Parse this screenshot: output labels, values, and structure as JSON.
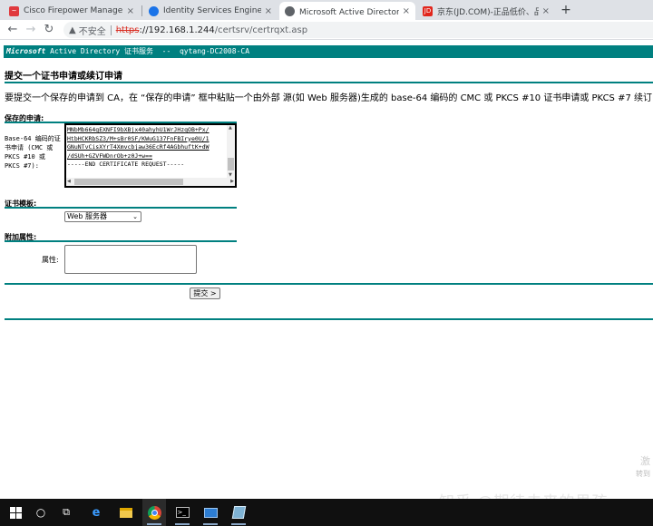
{
  "browser": {
    "tabs": [
      {
        "label": "Cisco Firepower Management",
        "close": "×",
        "favicon": "cisco-icon"
      },
      {
        "label": "Identity Services Engine",
        "close": "×",
        "favicon": "globe-icon"
      },
      {
        "label": "Microsoft Active Directory 证书",
        "close": "×",
        "favicon": "globe-icon"
      },
      {
        "label": "京东(JD.COM)-正品低价、品质保障",
        "close": "×",
        "favicon": "jd-icon",
        "favicon_text": "JD"
      }
    ],
    "new_tab": "+",
    "address": {
      "insecure_label": "不安全",
      "scheme": "https",
      "host": "://192.168.1.244",
      "path": "/certsrv/certrqxt.asp"
    }
  },
  "page": {
    "banner": {
      "brand": "Microsoft",
      "rest": " Active Directory 证书服务  --  qytang-DC2008-CA"
    },
    "heading": "提交一个证书申请或续订申请",
    "intro": "要提交一个保存的申请到 CA，在 “保存的申请” 框中粘贴一个由外部 源(如 Web 服务器)生成的 base-64 编码的 CMC 或 PKCS #10 证书申请或 PKCS #7 续订申",
    "saved_request": {
      "section_label": "保存的申请:",
      "field_label": "Base-64 编码的证书申请 (CMC 或 PKCS #10 或 PKCS #7):",
      "lines": [
        "MNbMb664gEXNFI9bXBjx40ahyhU1WrJHzqOB+Px/",
        "HtbHCKRbSZ3/M+sBr0SF/KWuG137FnFBIrye0U/1",
        "GNuNTvCisXYrT4Xmvcbjaw36EcRf4AGbhuftK+dW",
        "/dSUh+GZVFWDnrOb+z0J+w==",
        "-----END CERTIFICATE REQUEST-----"
      ]
    },
    "template": {
      "section_label": "证书模板:",
      "selected": "Web 服务器"
    },
    "attributes": {
      "section_label": "附加属性:",
      "field_label": "属性:",
      "value": ""
    },
    "submit_label": "提交 >",
    "watermark": "知乎 @期待未来的男孩",
    "corner_text_1": "激",
    "corner_text_2": "转到"
  },
  "colors": {
    "teal": "#008080",
    "tabstrip": "#dee1e6",
    "taskbar": "#101010",
    "insecure_scheme": "#d93025"
  },
  "taskbar": {
    "items": [
      "start-icon",
      "search-icon",
      "task-view-icon",
      "edge-icon",
      "file-explorer-icon",
      "chrome-icon",
      "terminal-icon",
      "remote-desktop-icon",
      "notepad-icon"
    ]
  }
}
